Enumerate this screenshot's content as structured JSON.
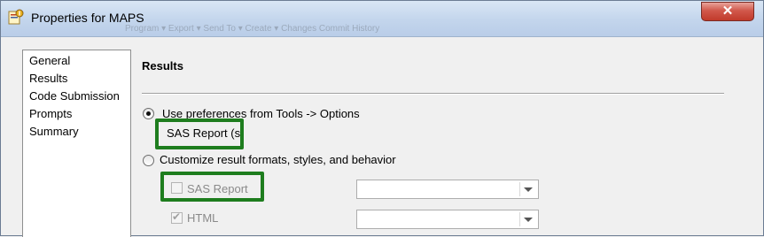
{
  "window": {
    "title": "Properties for MAPS",
    "close_label": "✕",
    "ghost_toolbar": "Program ▾   Export ▾   Send To ▾   Create ▾   Changes   Commit   History"
  },
  "nav": {
    "items": [
      {
        "label": "General"
      },
      {
        "label": "Results"
      },
      {
        "label": "Code Submission"
      },
      {
        "label": "Prompts"
      },
      {
        "label": "Summary"
      }
    ]
  },
  "results": {
    "title": "Results",
    "option_preferences": "Use preferences from Tools -> Options",
    "current_format": "SAS Report (s",
    "option_customize": "Customize result formats, styles, and behavior",
    "formats": [
      {
        "label": "SAS Report",
        "checked": false,
        "style_value": ""
      },
      {
        "label": "HTML",
        "checked": true,
        "style_value": ""
      }
    ]
  },
  "colors": {
    "highlight": "#1e7d1e",
    "close_button": "#c13a2b"
  }
}
